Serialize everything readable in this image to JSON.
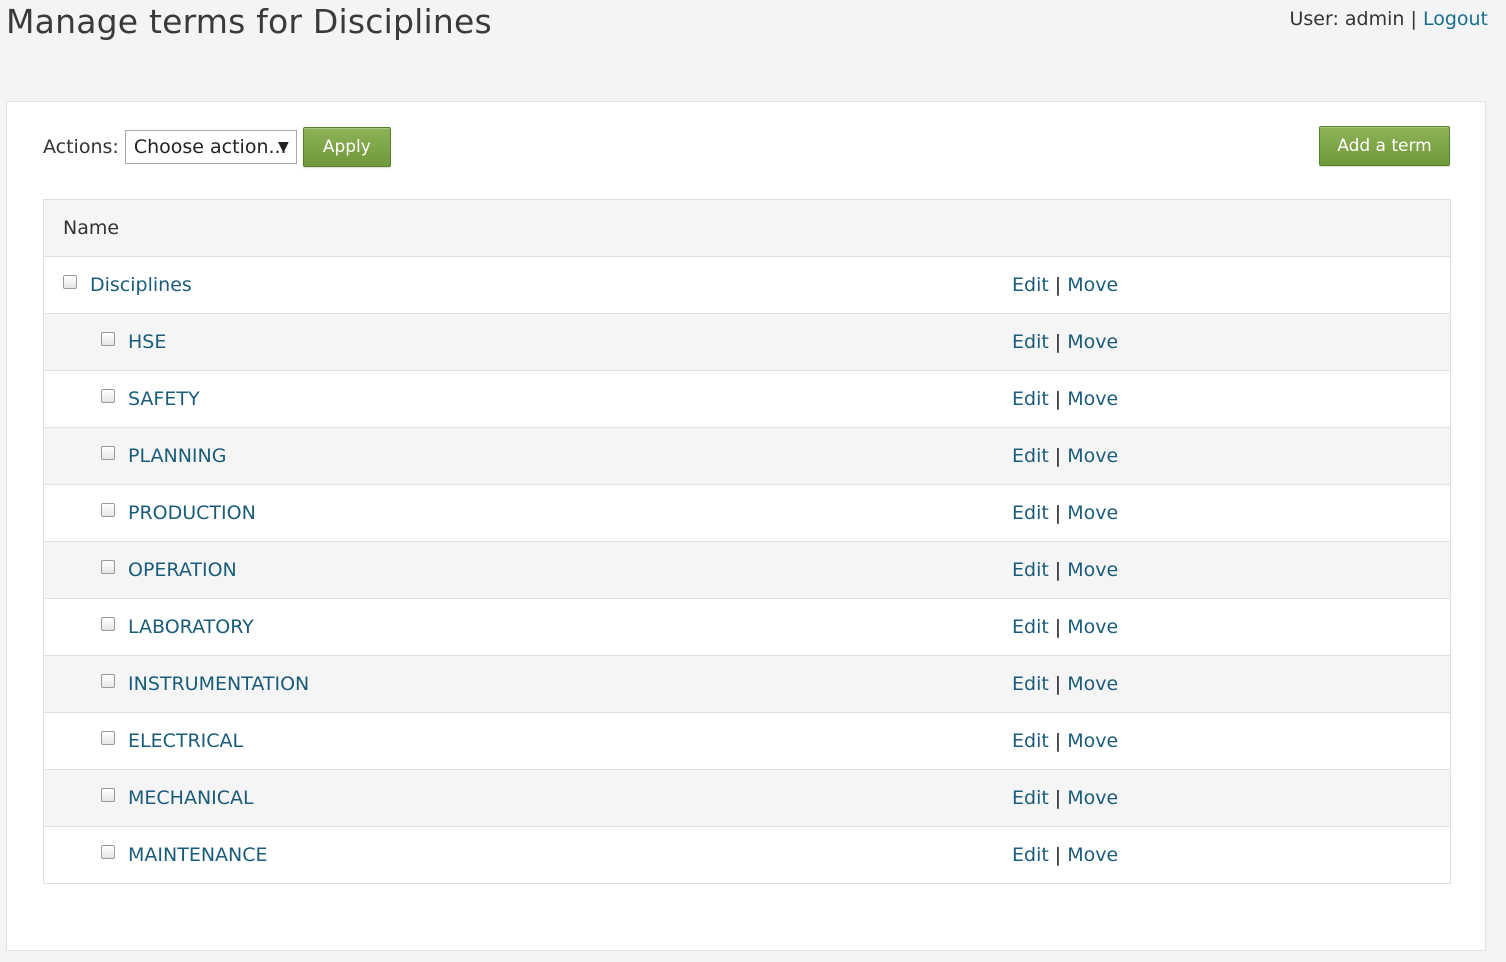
{
  "header": {
    "title": "Manage terms for Disciplines",
    "user_label": "User:",
    "user_name": "admin",
    "separator": "|",
    "logout_label": "Logout"
  },
  "toolbar": {
    "actions_label": "Actions:",
    "select_value": "Choose action...",
    "apply_label": "Apply",
    "add_term_label": "Add a term"
  },
  "table": {
    "column_name": "Name",
    "edit_label": "Edit",
    "move_label": "Move",
    "rows": [
      {
        "name": "Disciplines",
        "depth": 0
      },
      {
        "name": "HSE",
        "depth": 1
      },
      {
        "name": "SAFETY",
        "depth": 1
      },
      {
        "name": "PLANNING",
        "depth": 1
      },
      {
        "name": "PRODUCTION",
        "depth": 1
      },
      {
        "name": "OPERATION",
        "depth": 1
      },
      {
        "name": "LABORATORY",
        "depth": 1
      },
      {
        "name": "INSTRUMENTATION",
        "depth": 1
      },
      {
        "name": "ELECTRICAL",
        "depth": 1
      },
      {
        "name": "MECHANICAL",
        "depth": 1
      },
      {
        "name": "MAINTENANCE",
        "depth": 1
      }
    ]
  },
  "colors": {
    "accent_green": "#7aa345",
    "link_blue": "#1a5c7a"
  }
}
